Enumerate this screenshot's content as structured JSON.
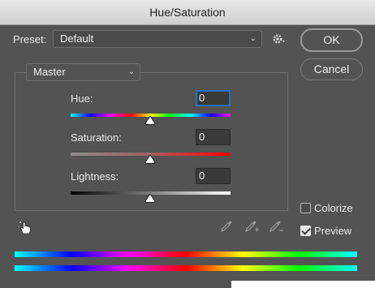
{
  "window": {
    "title": "Hue/Saturation"
  },
  "preset": {
    "label": "Preset:",
    "value": "Default"
  },
  "buttons": {
    "ok": "OK",
    "cancel": "Cancel"
  },
  "channel": {
    "value": "Master"
  },
  "sliders": {
    "hue": {
      "label": "Hue:",
      "value": "0"
    },
    "saturation": {
      "label": "Saturation:",
      "value": "0"
    },
    "lightness": {
      "label": "Lightness:",
      "value": "0"
    }
  },
  "options": {
    "colorize": {
      "label": "Colorize",
      "checked": false
    },
    "preview": {
      "label": "Preview",
      "checked": true
    }
  },
  "icons": [
    "gear-icon",
    "targeted-adjustment-hand-icon",
    "eyedropper-icon",
    "eyedropper-add-icon",
    "eyedropper-subtract-icon"
  ],
  "colors": {
    "dialog_bg": "#535353",
    "focus": "#2d6fc0"
  }
}
